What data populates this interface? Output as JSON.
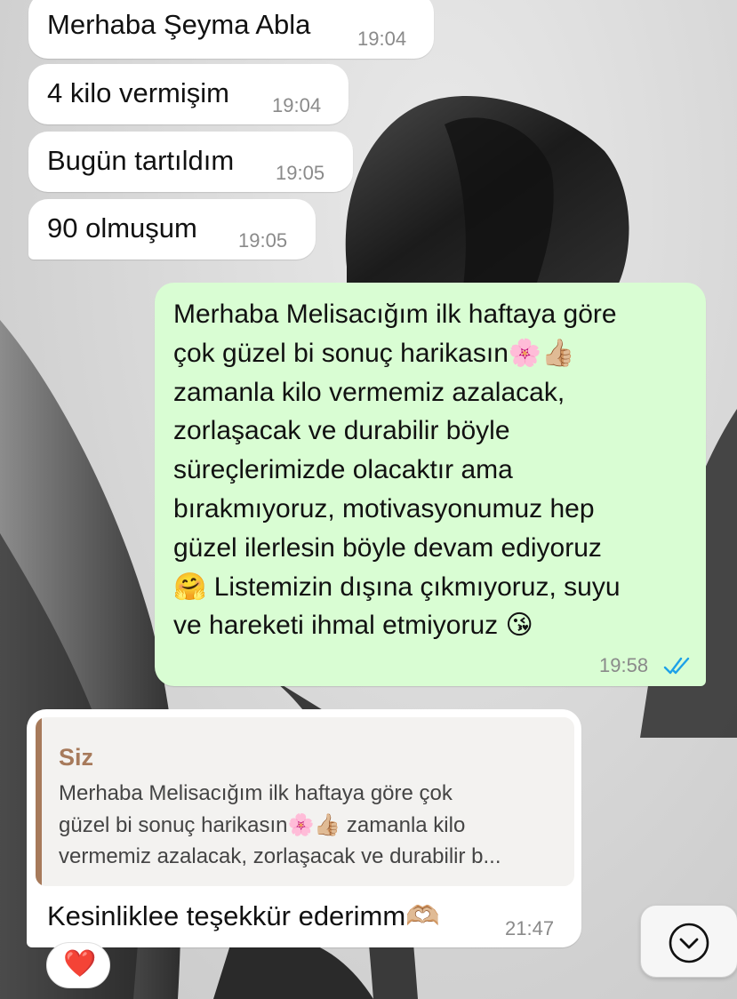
{
  "messages": {
    "m1": {
      "text": "Merhaba Şeyma Abla",
      "time": "19:04"
    },
    "m2": {
      "text": "4 kilo vermişim",
      "time": "19:04"
    },
    "m3": {
      "text": "Bugün tartıldım",
      "time": "19:05"
    },
    "m4": {
      "text": "90 olmuşum",
      "time": "19:05"
    },
    "m5": {
      "text": "Merhaba Melisacığım ilk haftaya göre\nçok güzel bi sonuç harikasın🌸👍🏼\nzamanla kilo vermemiz azalacak,\nzorlaşacak ve durabilir böyle\nsüreçlerimizde olacaktır ama\nbırakmıyoruz, motivasyonumuz hep\ngüzel ilerlesin böyle devam ediyoruz\n🤗 Listemizin dışına çıkmıyoruz, suyu\nve hareketi ihmal etmiyoruz 😘",
      "time": "19:58",
      "status_icon": "double-check-read-icon",
      "status_color": "#1ea1e8"
    },
    "m6": {
      "quote_author": "Siz",
      "quote_text": "Merhaba Melisacığım ilk haftaya göre çok\ngüzel bi sonuç harikasın🌸👍🏼 zamanla kilo\nvermemiz azalacak, zorlaşacak ve durabilir b...",
      "text": "Kesinliklee teşekkür ederimm🫶🏼",
      "time": "21:47",
      "reaction": "❤️"
    }
  },
  "scroll_button": {
    "icon": "chevron-down-circle-icon"
  },
  "colors": {
    "incoming_bubble": "#ffffff",
    "outgoing_bubble": "#d9fdd3",
    "quote_accent": "#a77a5b",
    "timestamp": "#8a8a8a"
  }
}
